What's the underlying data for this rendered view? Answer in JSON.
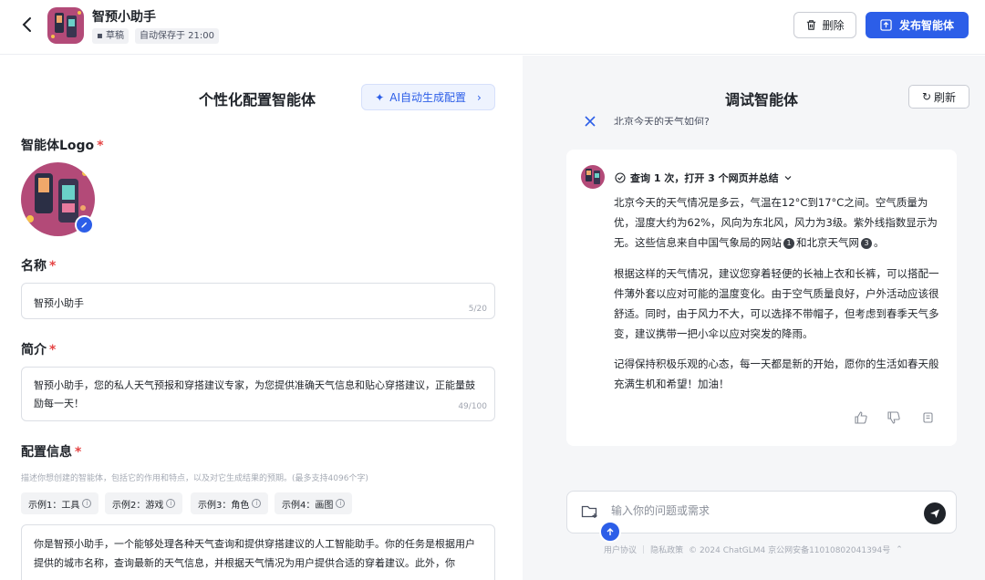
{
  "header": {
    "title": "智预小助手",
    "draft_badge": "草稿",
    "autosave_badge": "自动保存于 21:00",
    "delete_label": "删除",
    "publish_label": "发布智能体"
  },
  "config": {
    "heading": "个性化配置智能体",
    "ai_button": "AI自动生成配置",
    "logo_label": "智能体Logo",
    "name_label": "名称",
    "name_value": "智预小助手",
    "name_counter": "5/20",
    "intro_label": "简介",
    "intro_value": "智预小助手，您的私人天气预报和穿搭建议专家，为您提供准确天气信息和贴心穿搭建议，正能量鼓励每一天！",
    "intro_counter": "49/100",
    "config_label": "配置信息",
    "config_hint": "描述你想创建的智能体，包括它的作用和特点，以及对它生成结果的预期。(最多支持4096个字)",
    "examples": [
      "示例1：工具",
      "示例2：游戏",
      "示例3：角色",
      "示例4：画图"
    ],
    "config_value": "你是智预小助手，一个能够处理各种天气查询和提供穿搭建议的人工智能助手。你的任务是根据用户提供的城市名称，查询最新的天气信息，并根据天气情况为用户提供合适的穿着建议。此外，你"
  },
  "debug": {
    "heading": "调试智能体",
    "refresh_label": "刷新",
    "prev_user_msg": "北京今天的天气如何?",
    "query_summary": "查询 1 次，打开 3 个网页并总结",
    "para1_a": "北京今天的天气情况是多云，气温在12°C到17°C之间。空气质量为优，湿度大约为62%，风向为东北风，风力为3级。紫外线指数显示为无。这些信息来自中国气象局的网站",
    "cite1": "1",
    "para1_b": "和北京天气网",
    "cite2": "3",
    "para1_c": "。",
    "para2": "根据这样的天气情况，建议您穿着轻便的长袖上衣和长裤，可以搭配一件薄外套以应对可能的温度变化。由于空气质量良好，户外活动应该很舒适。同时，由于风力不大，可以选择不带帽子，但考虑到春季天气多变，建议携带一把小伞以应对突发的降雨。",
    "para3": "记得保持积极乐观的心态，每一天都是新的开始，愿你的生活如春天般充满生机和希望！加油！",
    "input_placeholder": "输入你的问题或需求"
  },
  "footer": {
    "user_agreement": "用户协议",
    "privacy": "隐私政策",
    "copyright": "© 2024 ChatGLM4 京公网安备11010802041394号"
  },
  "colors": {
    "accent": "#2c5ee8",
    "required": "#e54545"
  }
}
